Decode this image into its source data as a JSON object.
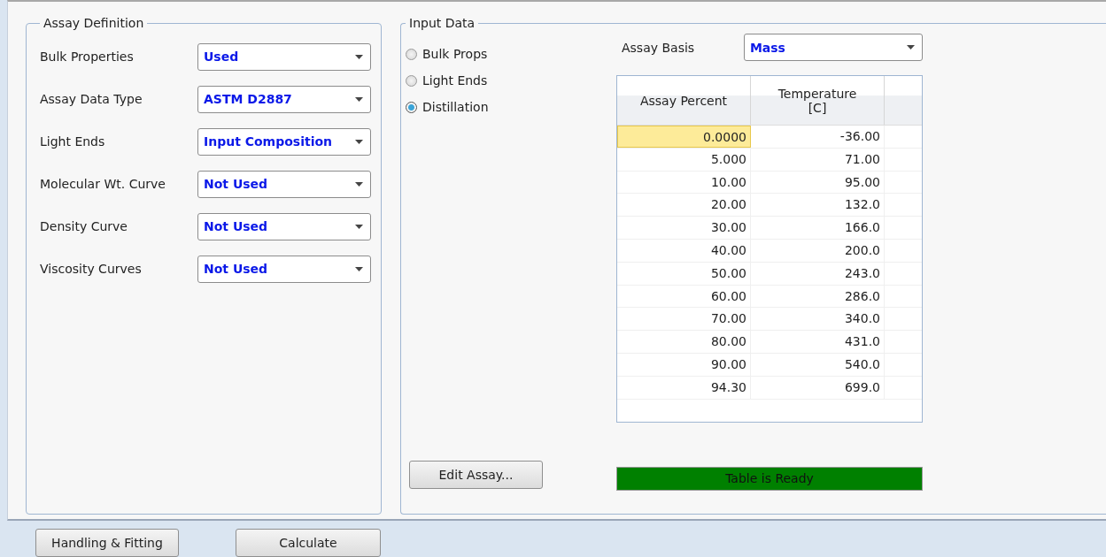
{
  "assay_definition": {
    "title": "Assay Definition",
    "fields": [
      {
        "label": "Bulk Properties",
        "value": "Used"
      },
      {
        "label": "Assay Data Type",
        "value": "ASTM D2887"
      },
      {
        "label": "Light Ends",
        "value": "Input Composition"
      },
      {
        "label": "Molecular Wt. Curve",
        "value": "Not Used"
      },
      {
        "label": "Density Curve",
        "value": "Not Used"
      },
      {
        "label": "Viscosity Curves",
        "value": "Not Used"
      }
    ]
  },
  "input_data": {
    "title": "Input Data",
    "options": [
      {
        "label": "Bulk Props",
        "selected": false
      },
      {
        "label": "Light Ends",
        "selected": false
      },
      {
        "label": "Distillation",
        "selected": true
      }
    ],
    "assay_basis": {
      "label": "Assay Basis",
      "value": "Mass"
    },
    "table": {
      "columns": [
        "Assay Percent",
        "Temperature\n[C]"
      ],
      "rows": [
        {
          "cells": [
            "0.0000",
            "-36.00"
          ],
          "selected": true
        },
        {
          "cells": [
            "5.000",
            "71.00"
          ],
          "selected": false
        },
        {
          "cells": [
            "10.00",
            "95.00"
          ],
          "selected": false
        },
        {
          "cells": [
            "20.00",
            "132.0"
          ],
          "selected": false
        },
        {
          "cells": [
            "30.00",
            "166.0"
          ],
          "selected": false
        },
        {
          "cells": [
            "40.00",
            "200.0"
          ],
          "selected": false
        },
        {
          "cells": [
            "50.00",
            "243.0"
          ],
          "selected": false
        },
        {
          "cells": [
            "60.00",
            "286.0"
          ],
          "selected": false
        },
        {
          "cells": [
            "70.00",
            "340.0"
          ],
          "selected": false
        },
        {
          "cells": [
            "80.00",
            "431.0"
          ],
          "selected": false
        },
        {
          "cells": [
            "90.00",
            "540.0"
          ],
          "selected": false
        },
        {
          "cells": [
            "94.30",
            "699.0"
          ],
          "selected": false
        }
      ]
    },
    "edit_button": "Edit Assay...",
    "status": {
      "text": "Table is Ready",
      "color": "#008000"
    }
  },
  "buttons": [
    "Handling & Fitting",
    "Calculate"
  ]
}
